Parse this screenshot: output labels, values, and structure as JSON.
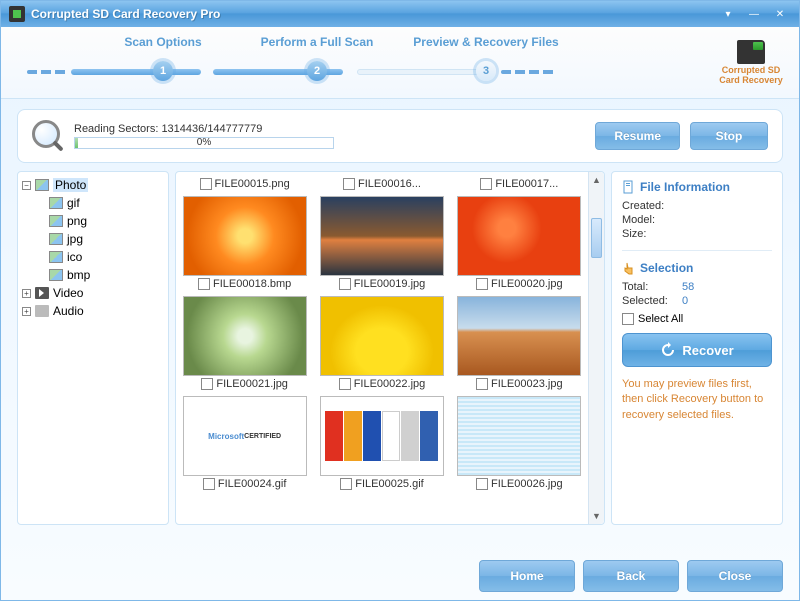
{
  "title": "Corrupted SD Card Recovery Pro",
  "brand": {
    "line1": "Corrupted SD",
    "line2": "Card Recovery"
  },
  "steps": [
    {
      "label": "Scan Options"
    },
    {
      "label": "Perform a Full Scan"
    },
    {
      "label": "Preview & Recovery Files"
    }
  ],
  "scan": {
    "status_prefix": "Reading Sectors: ",
    "sectors": "1314436/144777779",
    "progress_pct": "0%",
    "resume_label": "Resume",
    "stop_label": "Stop"
  },
  "tree": {
    "photo": {
      "label": "Photo",
      "expanded": true,
      "selected": true,
      "children": [
        {
          "label": "gif"
        },
        {
          "label": "png"
        },
        {
          "label": "jpg"
        },
        {
          "label": "ico"
        },
        {
          "label": "bmp"
        }
      ]
    },
    "video": {
      "label": "Video"
    },
    "audio": {
      "label": "Audio"
    }
  },
  "thumbs_top_row": [
    {
      "name": "FILE00015.png"
    },
    {
      "name": "FILE00016..."
    },
    {
      "name": "FILE00017..."
    }
  ],
  "thumbs": [
    {
      "name": "FILE00018.bmp",
      "img": "img-flower-orange"
    },
    {
      "name": "FILE00019.jpg",
      "img": "img-sunset"
    },
    {
      "name": "FILE00020.jpg",
      "img": "img-flower-red"
    },
    {
      "name": "FILE00021.jpg",
      "img": "img-hydrangea"
    },
    {
      "name": "FILE00022.jpg",
      "img": "img-tulips-yellow"
    },
    {
      "name": "FILE00023.jpg",
      "img": "img-desert"
    },
    {
      "name": "FILE00024.gif",
      "img": "img-logos1"
    },
    {
      "name": "FILE00025.gif",
      "img": "img-logos2"
    },
    {
      "name": "FILE00026.jpg",
      "img": "img-fabric"
    }
  ],
  "side": {
    "file_info_heading": "File Information",
    "created_label": "Created:",
    "model_label": "Model:",
    "size_label": "Size:",
    "selection_heading": "Selection",
    "total_label": "Total:",
    "total_value": "58",
    "selected_label": "Selected:",
    "selected_value": "0",
    "select_all_label": "Select All",
    "recover_label": "Recover",
    "hint": "You may preview files first, then click Recovery button to recovery selected files."
  },
  "footer": {
    "home": "Home",
    "back": "Back",
    "close": "Close"
  }
}
